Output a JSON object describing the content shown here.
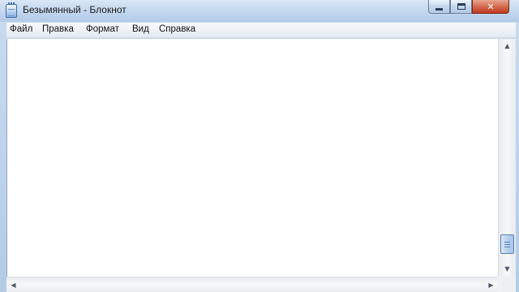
{
  "window": {
    "title": "Безымянный - Блокнот"
  },
  "caption_buttons": {
    "minimize_icon": "minimize-icon",
    "maximize_icon": "maximize-icon",
    "close_icon": "close-icon",
    "close_glyph": "✕"
  },
  "menu": {
    "items": [
      {
        "label": "Файл"
      },
      {
        "label": "Правка"
      },
      {
        "label": "Формат"
      },
      {
        "label": "Вид"
      },
      {
        "label": "Справка"
      }
    ]
  },
  "document": {
    "text": ""
  },
  "scrollbars": {
    "vertical_arrow_up": "▲",
    "vertical_arrow_down": "▼",
    "horizontal_arrow_left": "◀",
    "horizontal_arrow_right": "▶"
  },
  "colors": {
    "accent": "#c0391f",
    "frame": "#b4cbe5"
  }
}
